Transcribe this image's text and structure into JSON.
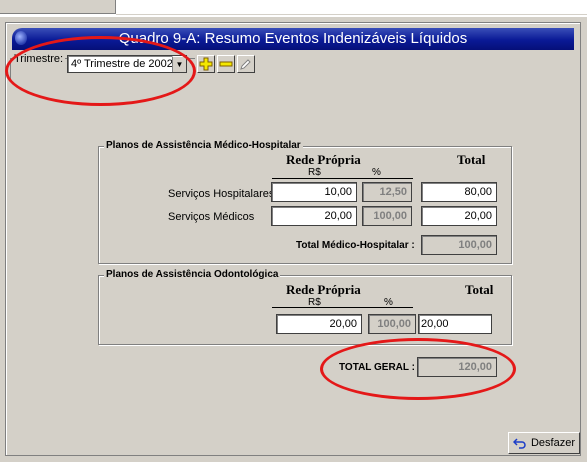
{
  "window": {
    "title": "Quadro 9-A: Resumo Eventos Indenizáveis Líquidos"
  },
  "trimestre": {
    "label": "Trimestre:",
    "selected": "4º Trimestre de 2002"
  },
  "toolbar": {
    "add_icon": "plus-icon",
    "remove_icon": "minus-icon",
    "edit_icon": "pencil-icon"
  },
  "medico": {
    "group_title": "Planos de Assistência Médico-Hospitalar",
    "col_rede": "Rede Própria",
    "col_total": "Total",
    "sub_rs": "R$",
    "sub_pct": "%",
    "rows": [
      {
        "label": "Serviços Hospitalares :",
        "rs": "10,00",
        "pct": "12,50",
        "total": "80,00"
      },
      {
        "label": "Serviços Médicos      :",
        "rs": "20,00",
        "pct": "100,00",
        "total": "20,00"
      }
    ],
    "total_label": "Total Médico-Hospitalar :",
    "total_value": "100,00"
  },
  "odonto": {
    "group_title": "Planos de Assistência Odontológica",
    "col_rede": "Rede Própria",
    "col_total": "Total",
    "sub_rs": "R$",
    "sub_pct": "%",
    "rs": "20,00",
    "pct": "100,00",
    "total": "20,00"
  },
  "geral": {
    "label": "TOTAL GERAL :",
    "value": "120,00"
  },
  "undo": {
    "label": "Desfazer",
    "icon": "undo-icon"
  },
  "colors": {
    "title_bg": "#0a1a96",
    "annotation": "#e41818",
    "panel": "#d4d0c8"
  }
}
